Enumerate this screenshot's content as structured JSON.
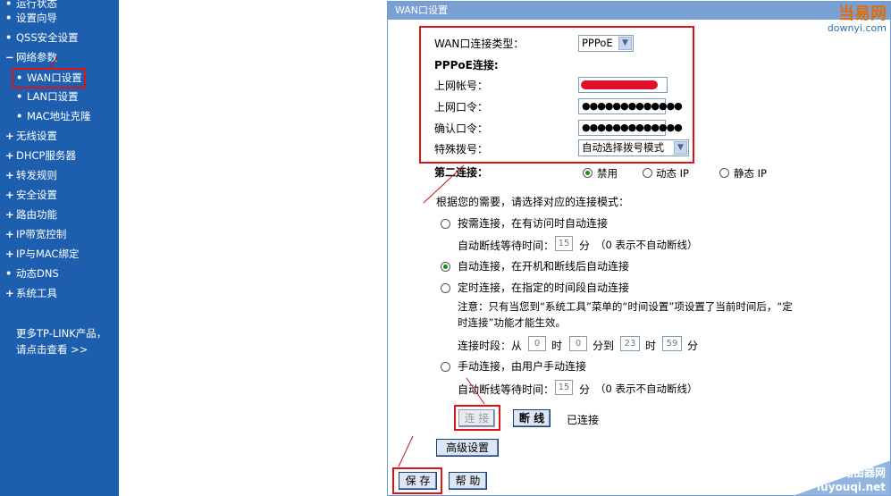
{
  "sidebar": {
    "items": [
      {
        "glyph": "•",
        "label": "运行状态"
      },
      {
        "glyph": "•",
        "label": "设置向导"
      },
      {
        "glyph": "•",
        "label": "QSS安全设置"
      },
      {
        "glyph": "−",
        "label": "网络参数"
      },
      {
        "glyph": "•",
        "label": "WAN口设置"
      },
      {
        "glyph": "•",
        "label": "LAN口设置"
      },
      {
        "glyph": "•",
        "label": "MAC地址克隆"
      },
      {
        "glyph": "+",
        "label": "无线设置"
      },
      {
        "glyph": "+",
        "label": "DHCP服务器"
      },
      {
        "glyph": "+",
        "label": "转发规则"
      },
      {
        "glyph": "+",
        "label": "安全设置"
      },
      {
        "glyph": "+",
        "label": "路由功能"
      },
      {
        "glyph": "+",
        "label": "IP带宽控制"
      },
      {
        "glyph": "+",
        "label": "IP与MAC绑定"
      },
      {
        "glyph": "•",
        "label": "动态DNS"
      },
      {
        "glyph": "+",
        "label": "系统工具"
      }
    ],
    "promo_line1": "更多TP-LINK产品，",
    "promo_line2": "请点击查看 >>"
  },
  "panel": {
    "title": "WAN口设置",
    "wan_type_label": "WAN口连接类型：",
    "wan_type_value": "PPPoE",
    "pppoe_heading": "PPPoE连接:",
    "account_label": "上网帐号：",
    "password_label": "上网口令：",
    "password_value": "●●●●●●●●●●●●●",
    "confirm_label": "确认口令：",
    "confirm_value": "●●●●●●●●●●●●●",
    "dial_label": "特殊拨号：",
    "dial_value": "自动选择拨号模式",
    "second_conn_label": "第二连接：",
    "second_conn_options": [
      "禁用",
      "动态 IP",
      "静态 IP"
    ],
    "mode_prompt": "根据您的需要，请选择对应的连接模式：",
    "mode_on_demand": "按需连接，在有访问时自动连接",
    "idle_label": "自动断线等待时间：",
    "idle_value": "15",
    "idle_unit": "分",
    "idle_note": "（0 表示不自动断线）",
    "mode_auto": "自动连接，在开机和断线后自动连接",
    "mode_timed": "定时连接，在指定的时间段自动连接",
    "note_line1": "注意：只有当您到“系统工具”菜单的“时间设置”项设置了当前时间后，“定",
    "note_line2": "时连接”功能才能生效。",
    "period_label": "连接时段：从",
    "period_from_h": "0",
    "hour_unit": "时",
    "period_from_m": "0",
    "to_label": "分到",
    "period_to_h": "23",
    "period_to_m": "59",
    "minute_unit": "分",
    "mode_manual": "手动连接，由用户手动连接",
    "idle2_value": "15",
    "connect_button": "连 接",
    "disconnect_button": "断 线",
    "status_text": "已连接",
    "advanced_button": "高级设置",
    "save_button": "保 存",
    "help_button": "帮 助"
  },
  "watermark": {
    "top_logo": "当易网",
    "top_domain": "downyi.com",
    "bottom_line1": "路由器网",
    "bottom_line2": "luyouqi.net"
  },
  "colors": {
    "sidebar_bg": "#1d5fae",
    "panel_title_bg": "#7a9fd3",
    "highlight_red": "#d9141a"
  }
}
